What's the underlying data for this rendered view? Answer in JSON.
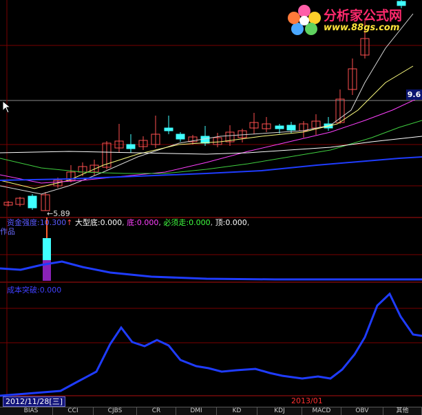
{
  "watermark": {
    "name": "分析家公式网",
    "url": "www.88gs.com"
  },
  "price_tag": "9.6",
  "low_label": "5.89",
  "panel2": {
    "line1": [
      {
        "label": "资金强度:",
        "value": "10.300",
        "color": "#5a5aff"
      },
      {
        "label": "大型底:",
        "value": "0.000",
        "color": "#ffffff"
      },
      {
        "label": "底:",
        "value": "0.000",
        "color": "#ff40ff"
      },
      {
        "label": "必须走:",
        "value": "0.000",
        "color": "#40ff40"
      },
      {
        "label": "顶:",
        "value": "0.000",
        "color": "#ffffff"
      }
    ],
    "line2": "作品"
  },
  "panel3": {
    "label": "成本突破:",
    "value": "0.000"
  },
  "date_box": "2012/11/28[三]",
  "month_label": "2013/01",
  "tabs": [
    "BIAS",
    "CCI",
    "CJBS",
    "CR",
    "DMI",
    "KD",
    "KDJ",
    "MACD",
    "OBV",
    "其他"
  ],
  "colors": {
    "up": "#ff5050",
    "down": "#40ffff",
    "ma1": "#ffffff",
    "ma2": "#ffff80",
    "ma3": "#ff40ff",
    "ma4": "#40d040",
    "ma5": "#2040ff",
    "grid": "#7a0000"
  }
}
